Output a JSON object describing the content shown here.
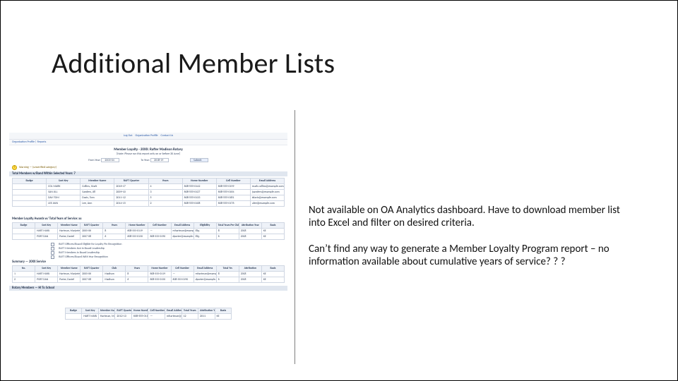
{
  "title": "Additional Member Lists",
  "body": {
    "p1": "Not available on OA Analytics dashboard. Have to download member list into Excel and filter on desired criteria.",
    "p2": "Can’t find any way to generate a Member Loyalty Program report – no information available about cumulative years of service? ? ?"
  },
  "shot1": {
    "top_links": [
      "Log Out",
      "Organization Profile",
      "Contact Us"
    ],
    "tabs": "Organization Profile  |  Reports",
    "report_title": "Member Loyalty - 20XX: Rafter Madison Rotary",
    "subtitle": "[Note: Please run this report only on or before 30 June]",
    "filter_labels": {
      "from": "From Year:",
      "to": "To Year:"
    },
    "filter_values": {
      "from": "2003-04",
      "to": "2018-19",
      "btn": "Submit"
    },
    "warning": "Warning — (unverified category)",
    "section": "Total Members w/Band Within Selected Years: 7",
    "cols": [
      "Badge",
      "Sort Key",
      "Member Name",
      "RAFT Quarter",
      "Years",
      "Home Number",
      "Cell Number",
      "Email Address"
    ],
    "rows": [
      [
        "",
        "COL MARK",
        "Collins, Mark",
        "2016-17",
        "4",
        "608-555-0142",
        "608-555-0199",
        "mark.collins@example.com"
      ],
      [
        "",
        "SAN JILL",
        "Sanders, Jill",
        "2009-10",
        "3",
        "608-555-0127",
        "608-555-0164",
        "jsanders@example.com"
      ],
      [
        "",
        "DAV TOM",
        "Davis, Tom",
        "2011-12",
        "5",
        "608-555-0133",
        "608-555-0181",
        "tdavis@example.com"
      ],
      [
        "",
        "LEE ANN",
        "Lee, Ann",
        "2014-15",
        "2",
        "608-555-0108",
        "608-555-0176",
        "alee@example.com"
      ]
    ]
  },
  "shot2": {
    "band1_title": "Member Loyalty Awards w/ Total Years of Service: xx",
    "cols_wide": [
      "Badge",
      "Sort Key",
      "Member Name",
      "RAFT Quarter",
      "Years",
      "Home Number",
      "Cell Number",
      "Email Address",
      "Eligibility",
      "Total Years Per Club",
      "Attribution Year",
      "Basis"
    ],
    "rows_wide": [
      [
        "",
        "HART MARJ",
        "Hartman, Marjorie",
        "2005-06",
        "8",
        "608-555-0119",
        "—",
        "mhartman@example.com",
        "Elig.",
        "8",
        "2018",
        "KE"
      ],
      [
        "",
        "PORT DAN",
        "Porter, Daniel",
        "2007-08",
        "6",
        "608-555-0150",
        "608-555-0190",
        "dporter@example.com",
        "Elig.",
        "6",
        "2018",
        "KE"
      ]
    ],
    "legend_lines": [
      "RAFT Officers/Board Eligible for Loyalty Pin Recognition",
      "RAFT Members Not in Board Leadership",
      "RAFT Members in Board Leadership",
      "RAFT Officers/Board With Year Recognition"
    ],
    "band2_title": "Summary — 20XX Service",
    "band2_cols": [
      "No.",
      "Sort Key",
      "Member Name",
      "RAFT Quarter",
      "Club",
      "Years",
      "Home Number",
      "Cell Number",
      "Email Address",
      "Total Yrs",
      "Attribution",
      "Basis"
    ],
    "band2_rows": [
      [
        "1",
        "HART MARJ",
        "Hartman, Marjorie",
        "2005-06",
        "Madison",
        "8",
        "608-555-0119",
        "—",
        "mhartman@example.com",
        "8",
        "2018",
        "KE"
      ],
      [
        "2",
        "PORT DAN",
        "Porter, Daniel",
        "2007-08",
        "Madison",
        "6",
        "608-555-0150",
        "608-555-0190",
        "dporter@example.com",
        "6",
        "2018",
        "KE"
      ]
    ],
    "footer_section": "Rotary Members — HI To School"
  },
  "shot3": {
    "cols": [
      "Badge",
      "Sort Key",
      "Member Name",
      "RAFT Quarter",
      "Home Number",
      "Cell Number",
      "Email Address",
      "Total Years",
      "Attribution Year",
      "Basis"
    ],
    "rows": [
      [
        "",
        "HART MARJ",
        "Hartman, Marjorie",
        "2012-13",
        "608-555-0119",
        "—",
        "mhartman@example.com",
        "12",
        "2011",
        "KE"
      ]
    ]
  }
}
